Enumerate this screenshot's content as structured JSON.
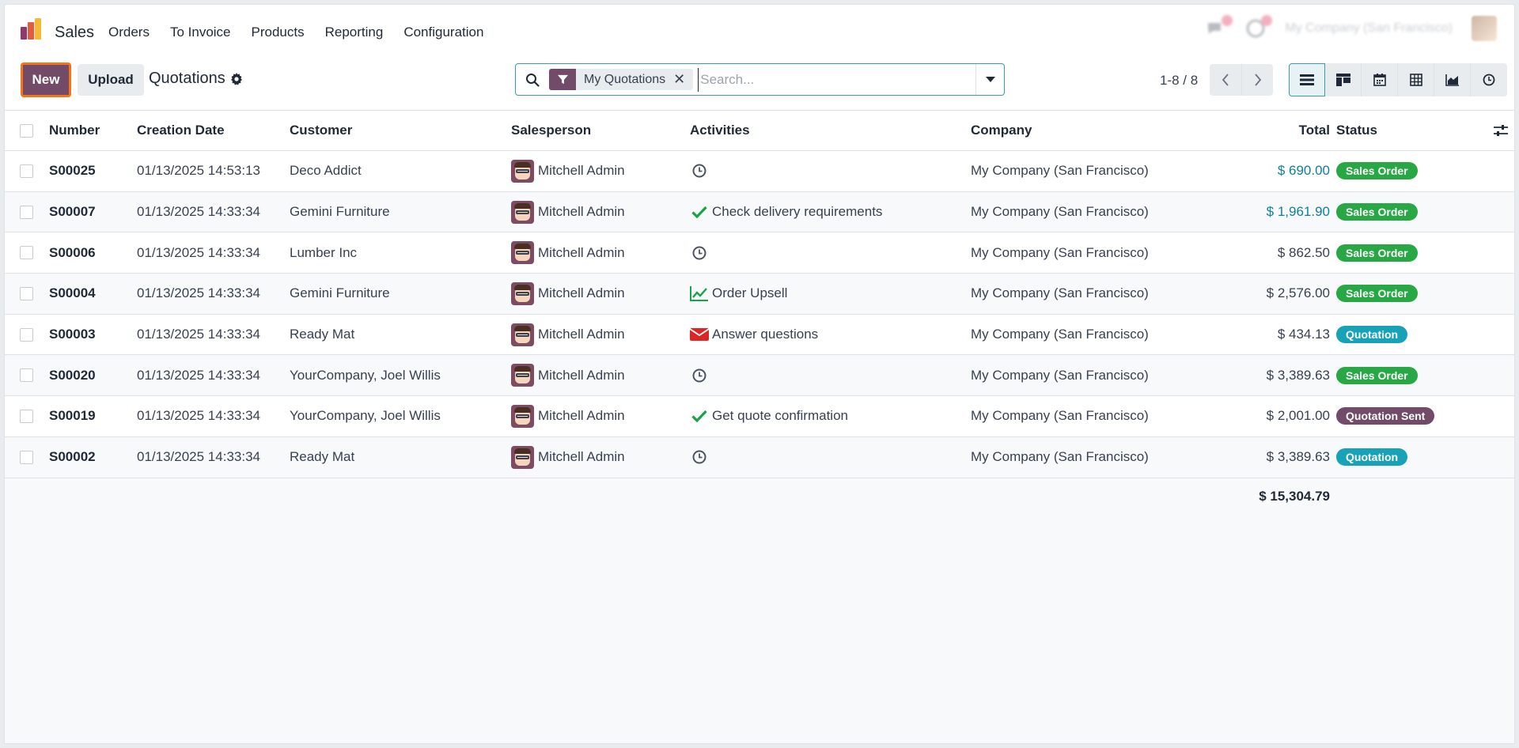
{
  "app": {
    "name": "Sales"
  },
  "menu": [
    "Orders",
    "To Invoice",
    "Products",
    "Reporting",
    "Configuration"
  ],
  "system": {
    "company": "My Company (San Francisco)"
  },
  "control": {
    "new_label": "New",
    "upload_label": "Upload",
    "breadcrumb": "Quotations",
    "facet_label": "My Quotations",
    "facet_remove": "✕",
    "search_placeholder": "Search...",
    "pager": "1-8 / 8"
  },
  "table": {
    "headers": {
      "number": "Number",
      "date": "Creation Date",
      "customer": "Customer",
      "salesperson": "Salesperson",
      "activities": "Activities",
      "company": "Company",
      "total": "Total",
      "status": "Status"
    },
    "rows": [
      {
        "number": "S00025",
        "date": "01/13/2025 14:53:13",
        "customer": "Deco Addict",
        "salesperson": "Mitchell Admin",
        "activity_icon": "clock-icon",
        "activity": "",
        "company": "My Company (San Francisco)",
        "total": "$ 690.00",
        "total_link": true,
        "status": "Sales Order",
        "status_kind": "sales"
      },
      {
        "number": "S00007",
        "date": "01/13/2025 14:33:34",
        "customer": "Gemini Furniture",
        "salesperson": "Mitchell Admin",
        "activity_icon": "check-icon",
        "activity": "Check delivery requirements",
        "company": "My Company (San Francisco)",
        "total": "$ 1,961.90",
        "total_link": true,
        "status": "Sales Order",
        "status_kind": "sales"
      },
      {
        "number": "S00006",
        "date": "01/13/2025 14:33:34",
        "customer": "Lumber Inc",
        "salesperson": "Mitchell Admin",
        "activity_icon": "clock-icon",
        "activity": "",
        "company": "My Company (San Francisco)",
        "total": "$ 862.50",
        "total_link": false,
        "status": "Sales Order",
        "status_kind": "sales"
      },
      {
        "number": "S00004",
        "date": "01/13/2025 14:33:34",
        "customer": "Gemini Furniture",
        "salesperson": "Mitchell Admin",
        "activity_icon": "chart-line-icon",
        "activity": "Order Upsell",
        "company": "My Company (San Francisco)",
        "total": "$ 2,576.00",
        "total_link": false,
        "status": "Sales Order",
        "status_kind": "sales"
      },
      {
        "number": "S00003",
        "date": "01/13/2025 14:33:34",
        "customer": "Ready Mat",
        "salesperson": "Mitchell Admin",
        "activity_icon": "envelope-icon",
        "activity": "Answer questions",
        "company": "My Company (San Francisco)",
        "total": "$ 434.13",
        "total_link": false,
        "status": "Quotation",
        "status_kind": "quot"
      },
      {
        "number": "S00020",
        "date": "01/13/2025 14:33:34",
        "customer": "YourCompany, Joel Willis",
        "salesperson": "Mitchell Admin",
        "activity_icon": "clock-icon",
        "activity": "",
        "company": "My Company (San Francisco)",
        "total": "$ 3,389.63",
        "total_link": false,
        "status": "Sales Order",
        "status_kind": "sales"
      },
      {
        "number": "S00019",
        "date": "01/13/2025 14:33:34",
        "customer": "YourCompany, Joel Willis",
        "salesperson": "Mitchell Admin",
        "activity_icon": "check-icon",
        "activity": "Get quote confirmation",
        "company": "My Company (San Francisco)",
        "total": "$ 2,001.00",
        "total_link": false,
        "status": "Quotation Sent",
        "status_kind": "sent"
      },
      {
        "number": "S00002",
        "date": "01/13/2025 14:33:34",
        "customer": "Ready Mat",
        "salesperson": "Mitchell Admin",
        "activity_icon": "clock-icon",
        "activity": "",
        "company": "My Company (San Francisco)",
        "total": "$ 3,389.63",
        "total_link": false,
        "status": "Quotation",
        "status_kind": "quot"
      }
    ],
    "sum_total": "$ 15,304.79"
  },
  "colors": {
    "brand": "#714b67",
    "accent": "#3d9aa6",
    "success": "#28a745",
    "info": "#17a2b8",
    "link": "#0f7fa0"
  }
}
